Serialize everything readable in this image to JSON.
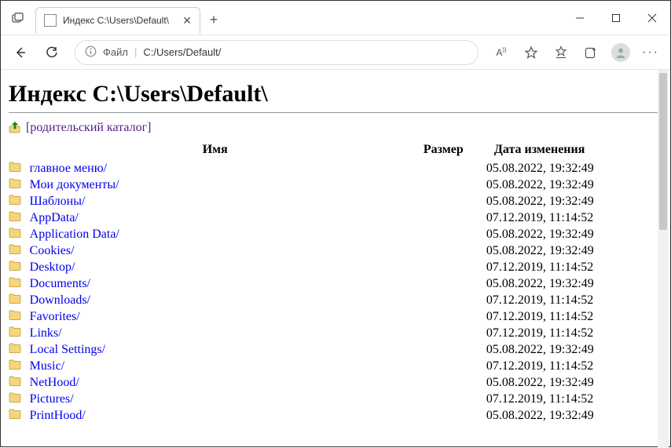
{
  "tab": {
    "title": "Индекс C:\\Users\\Default\\"
  },
  "addressbar": {
    "file_label": "Файл",
    "path": "C:/Users/Default/"
  },
  "page": {
    "heading": "Индекс C:\\Users\\Default\\",
    "parent_link": "[родительский каталог]",
    "columns": {
      "name": "Имя",
      "size": "Размер",
      "date": "Дата изменения"
    }
  },
  "entries": [
    {
      "name": "главное меню/",
      "size": "",
      "date": "05.08.2022, 19:32:49"
    },
    {
      "name": "Мои документы/",
      "size": "",
      "date": "05.08.2022, 19:32:49"
    },
    {
      "name": "Шаблоны/",
      "size": "",
      "date": "05.08.2022, 19:32:49"
    },
    {
      "name": "AppData/",
      "size": "",
      "date": "07.12.2019, 11:14:52"
    },
    {
      "name": "Application Data/",
      "size": "",
      "date": "05.08.2022, 19:32:49"
    },
    {
      "name": "Cookies/",
      "size": "",
      "date": "05.08.2022, 19:32:49"
    },
    {
      "name": "Desktop/",
      "size": "",
      "date": "07.12.2019, 11:14:52"
    },
    {
      "name": "Documents/",
      "size": "",
      "date": "05.08.2022, 19:32:49"
    },
    {
      "name": "Downloads/",
      "size": "",
      "date": "07.12.2019, 11:14:52"
    },
    {
      "name": "Favorites/",
      "size": "",
      "date": "07.12.2019, 11:14:52"
    },
    {
      "name": "Links/",
      "size": "",
      "date": "07.12.2019, 11:14:52"
    },
    {
      "name": "Local Settings/",
      "size": "",
      "date": "05.08.2022, 19:32:49"
    },
    {
      "name": "Music/",
      "size": "",
      "date": "07.12.2019, 11:14:52"
    },
    {
      "name": "NetHood/",
      "size": "",
      "date": "05.08.2022, 19:32:49"
    },
    {
      "name": "Pictures/",
      "size": "",
      "date": "07.12.2019, 11:14:52"
    },
    {
      "name": "PrintHood/",
      "size": "",
      "date": "05.08.2022, 19:32:49"
    }
  ]
}
